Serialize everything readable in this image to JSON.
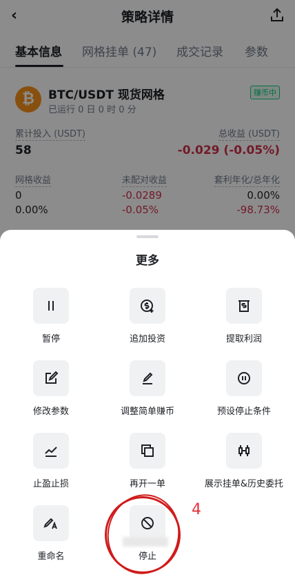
{
  "header": {
    "back_icon": "‹",
    "title": "策略详情",
    "share_icon": "share-icon"
  },
  "tabs": [
    {
      "label": "基本信息",
      "active": true
    },
    {
      "label": "网格挂单 (47)",
      "active": false
    },
    {
      "label": "成交记录",
      "active": false
    },
    {
      "label": "参数",
      "active": false
    }
  ],
  "strategy": {
    "coin_symbol": "₿",
    "name": "BTC/USDT 现货网格",
    "running": "已运行 0 日 0 时 0 分",
    "badge": "赚币中"
  },
  "summary": {
    "invest_label": "累计投入 (USDT)",
    "invest_value": "58",
    "profit_label": "总收益 (USDT)",
    "profit_value": "-0.029 (-0.05%)"
  },
  "metrics": {
    "grid_label": "网格收益",
    "grid_value": "0",
    "grid_pct": "0.00%",
    "unmatched_label": "未配对收益",
    "unmatched_value": "-0.0289",
    "unmatched_pct": "-0.05%",
    "arb_label": "套利年化/总年化",
    "arb_value": "0.00%",
    "arb_pct": "-98.73%"
  },
  "sheet": {
    "title": "更多",
    "items": [
      {
        "label": "暂停",
        "icon": "pause-icon"
      },
      {
        "label": "追加投资",
        "icon": "add-funds-icon"
      },
      {
        "label": "提取利润",
        "icon": "withdraw-icon"
      },
      {
        "label": "修改参数",
        "icon": "edit-icon"
      },
      {
        "label": "调整简单赚币",
        "icon": "pencil-icon"
      },
      {
        "label": "预设停止条件",
        "icon": "pause-circle-icon"
      },
      {
        "label": "止盈止损",
        "icon": "chart-line-icon"
      },
      {
        "label": "再开一单",
        "icon": "copy-icon"
      },
      {
        "label": "展示挂单&历史委托",
        "icon": "candlestick-icon"
      },
      {
        "label": "重命名",
        "icon": "rename-icon"
      },
      {
        "label": "停止",
        "icon": "stop-icon"
      }
    ]
  },
  "annotation": {
    "number": "4",
    "color": "#d01b1b"
  }
}
